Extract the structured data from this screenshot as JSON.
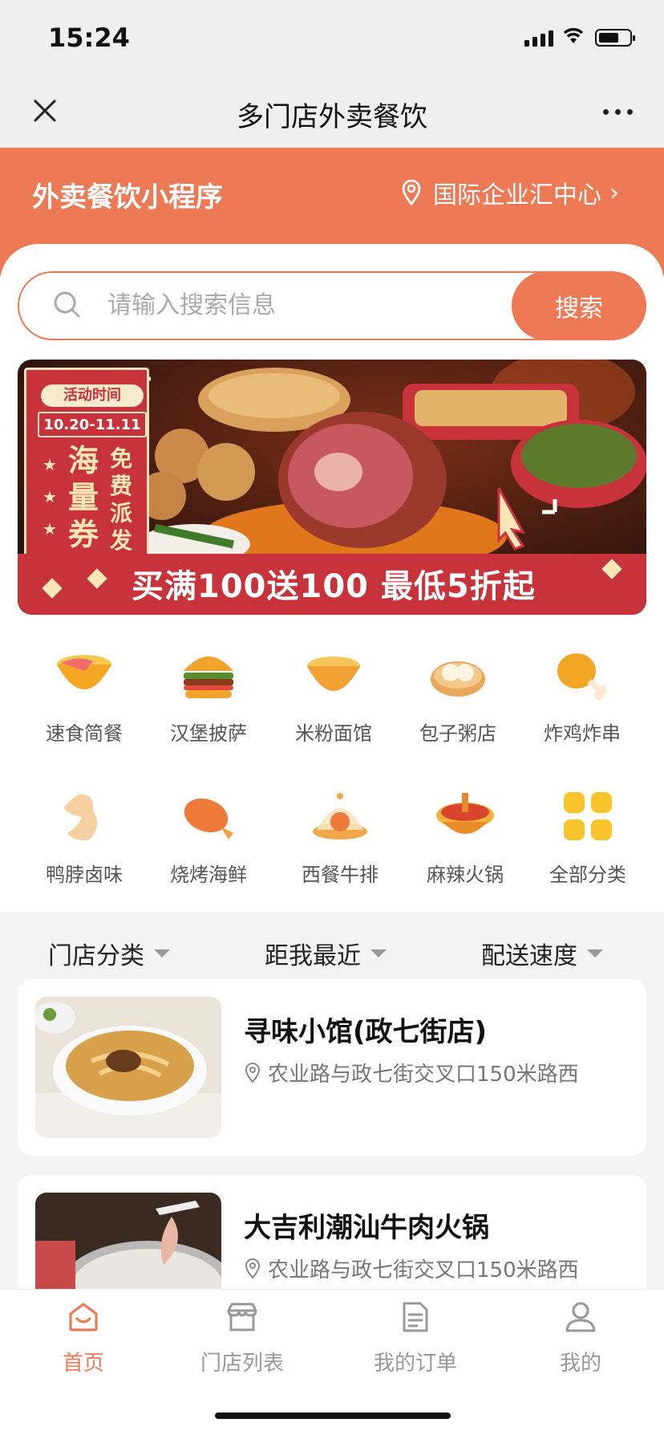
{
  "status_bar": {
    "time": "15:24"
  },
  "nav": {
    "title": "多门店外卖餐饮"
  },
  "header": {
    "app_name": "外卖餐饮小程序",
    "location": "国际企业汇中心",
    "accent_color": "#ee7a55"
  },
  "search": {
    "placeholder": "请输入搜索信息",
    "value": "",
    "button_label": "搜索"
  },
  "banner": {
    "tag": "活动时间",
    "date": "10.20-11.11",
    "headline_big": "海量券",
    "headline_small": "免费派发",
    "promo": "买满100送100  最低5折起"
  },
  "categories": [
    {
      "label": "速食简餐",
      "icon": "bowl-icon"
    },
    {
      "label": "汉堡披萨",
      "icon": "burger-icon"
    },
    {
      "label": "米粉面馆",
      "icon": "noodle-bowl-icon"
    },
    {
      "label": "包子粥店",
      "icon": "steamed-bun-icon"
    },
    {
      "label": "炸鸡炸串",
      "icon": "drumstick-icon"
    },
    {
      "label": "鸭脖卤味",
      "icon": "duck-icon"
    },
    {
      "label": "烧烤海鲜",
      "icon": "shrimp-icon"
    },
    {
      "label": "西餐牛排",
      "icon": "cloche-icon"
    },
    {
      "label": "麻辣火锅",
      "icon": "hotpot-icon"
    },
    {
      "label": "全部分类",
      "icon": "grid-icon"
    }
  ],
  "filters": [
    {
      "label": "门店分类"
    },
    {
      "label": "距我最近"
    },
    {
      "label": "配送速度"
    }
  ],
  "stores": [
    {
      "name": "寻味小馆(政七街店)",
      "address": "农业路与政七街交叉口150米路西"
    },
    {
      "name": "大吉利潮汕牛肉火锅",
      "address": "农业路与政七街交叉口150米路西"
    }
  ],
  "tabs": [
    {
      "label": "首页",
      "icon": "home-icon",
      "active": true
    },
    {
      "label": "门店列表",
      "icon": "store-icon",
      "active": false
    },
    {
      "label": "我的订单",
      "icon": "order-icon",
      "active": false
    },
    {
      "label": "我的",
      "icon": "user-icon",
      "active": false
    }
  ]
}
